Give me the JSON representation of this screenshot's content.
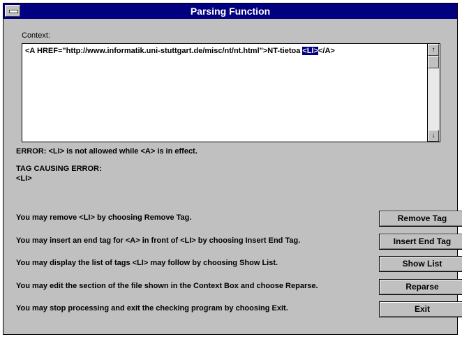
{
  "window": {
    "title": "Parsing Function"
  },
  "context": {
    "label": "Context:",
    "text_before": "<A HREF=\"http://www.informatik.uni-stuttgart.de/misc/nt/nt.html\">NT-tietoa ",
    "highlight": "<LI>",
    "text_after": "</A>",
    "scroll_up": "↑",
    "scroll_down": "↓"
  },
  "error": {
    "message": "ERROR:  <LI> is not allowed while <A> is in effect.",
    "tag_label": "TAG CAUSING ERROR:",
    "tag": "<LI>"
  },
  "options": [
    {
      "text": "You may remove <LI> by choosing Remove Tag.",
      "button": "Remove Tag"
    },
    {
      "text": "You may insert an end tag for <A> in front of <LI> by choosing Insert End Tag.",
      "button": "Insert End Tag"
    },
    {
      "text": "You may display the list of tags <LI> may follow by choosing Show List.",
      "button": "Show List"
    },
    {
      "text": "You may edit the section of the file shown in the Context Box and choose Reparse.",
      "button": "Reparse"
    },
    {
      "text": "You may stop processing and exit the checking program by choosing Exit.",
      "button": "Exit"
    }
  ],
  "colors": {
    "titlebar": "#000080",
    "window_bg": "#c0c0c0",
    "highlight": "#000080"
  }
}
